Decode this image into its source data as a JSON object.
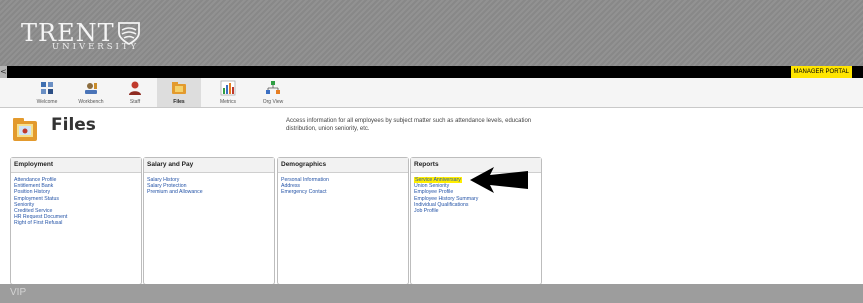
{
  "header": {
    "logo_main": "TRENT",
    "logo_sub": "UNIVERSITY",
    "manager_portal": "MANAGER PORTAL",
    "nav_arrow": "<"
  },
  "toolbar": {
    "items": [
      {
        "label": "Welcome",
        "icon": "welcome-icon"
      },
      {
        "label": "Workbench",
        "icon": "workbench-icon"
      },
      {
        "label": "Staff",
        "icon": "staff-icon"
      },
      {
        "label": "Files",
        "icon": "files-icon"
      },
      {
        "label": "Metrics",
        "icon": "metrics-icon"
      },
      {
        "label": "Org View",
        "icon": "org-view-icon"
      }
    ],
    "active": "Files"
  },
  "page": {
    "title": "Files",
    "description": "Access information for all employees by subject matter such as attendance levels, education distribution, union seniority, etc."
  },
  "panels": [
    {
      "title": "Employment",
      "items": [
        "Attendance Profile",
        "Entitlement Bank",
        "Position History",
        "Employment Status",
        "Seniority",
        "Credited Service",
        "HR Request Document",
        "Right of First Refusal"
      ]
    },
    {
      "title": "Salary and Pay",
      "items": [
        "Salary History",
        "Salary Protection",
        "Premium and Allowance"
      ]
    },
    {
      "title": "Demographics",
      "items": [
        "Personal Information",
        "Address",
        "Emergency Contact"
      ]
    },
    {
      "title": "Reports",
      "items": [
        "Service Anniversary",
        "Union Seniority",
        "Employee Profile",
        "Employee History Summary",
        "Individual Qualifications",
        "Job Profile"
      ],
      "highlighted": "Service Anniversary"
    }
  ],
  "footer": {
    "text": "VIP"
  },
  "colors": {
    "header_bg": "#8c8c8c",
    "highlight": "#ffee00",
    "link": "#2554a7",
    "footer_bg": "#9d9d9d"
  }
}
